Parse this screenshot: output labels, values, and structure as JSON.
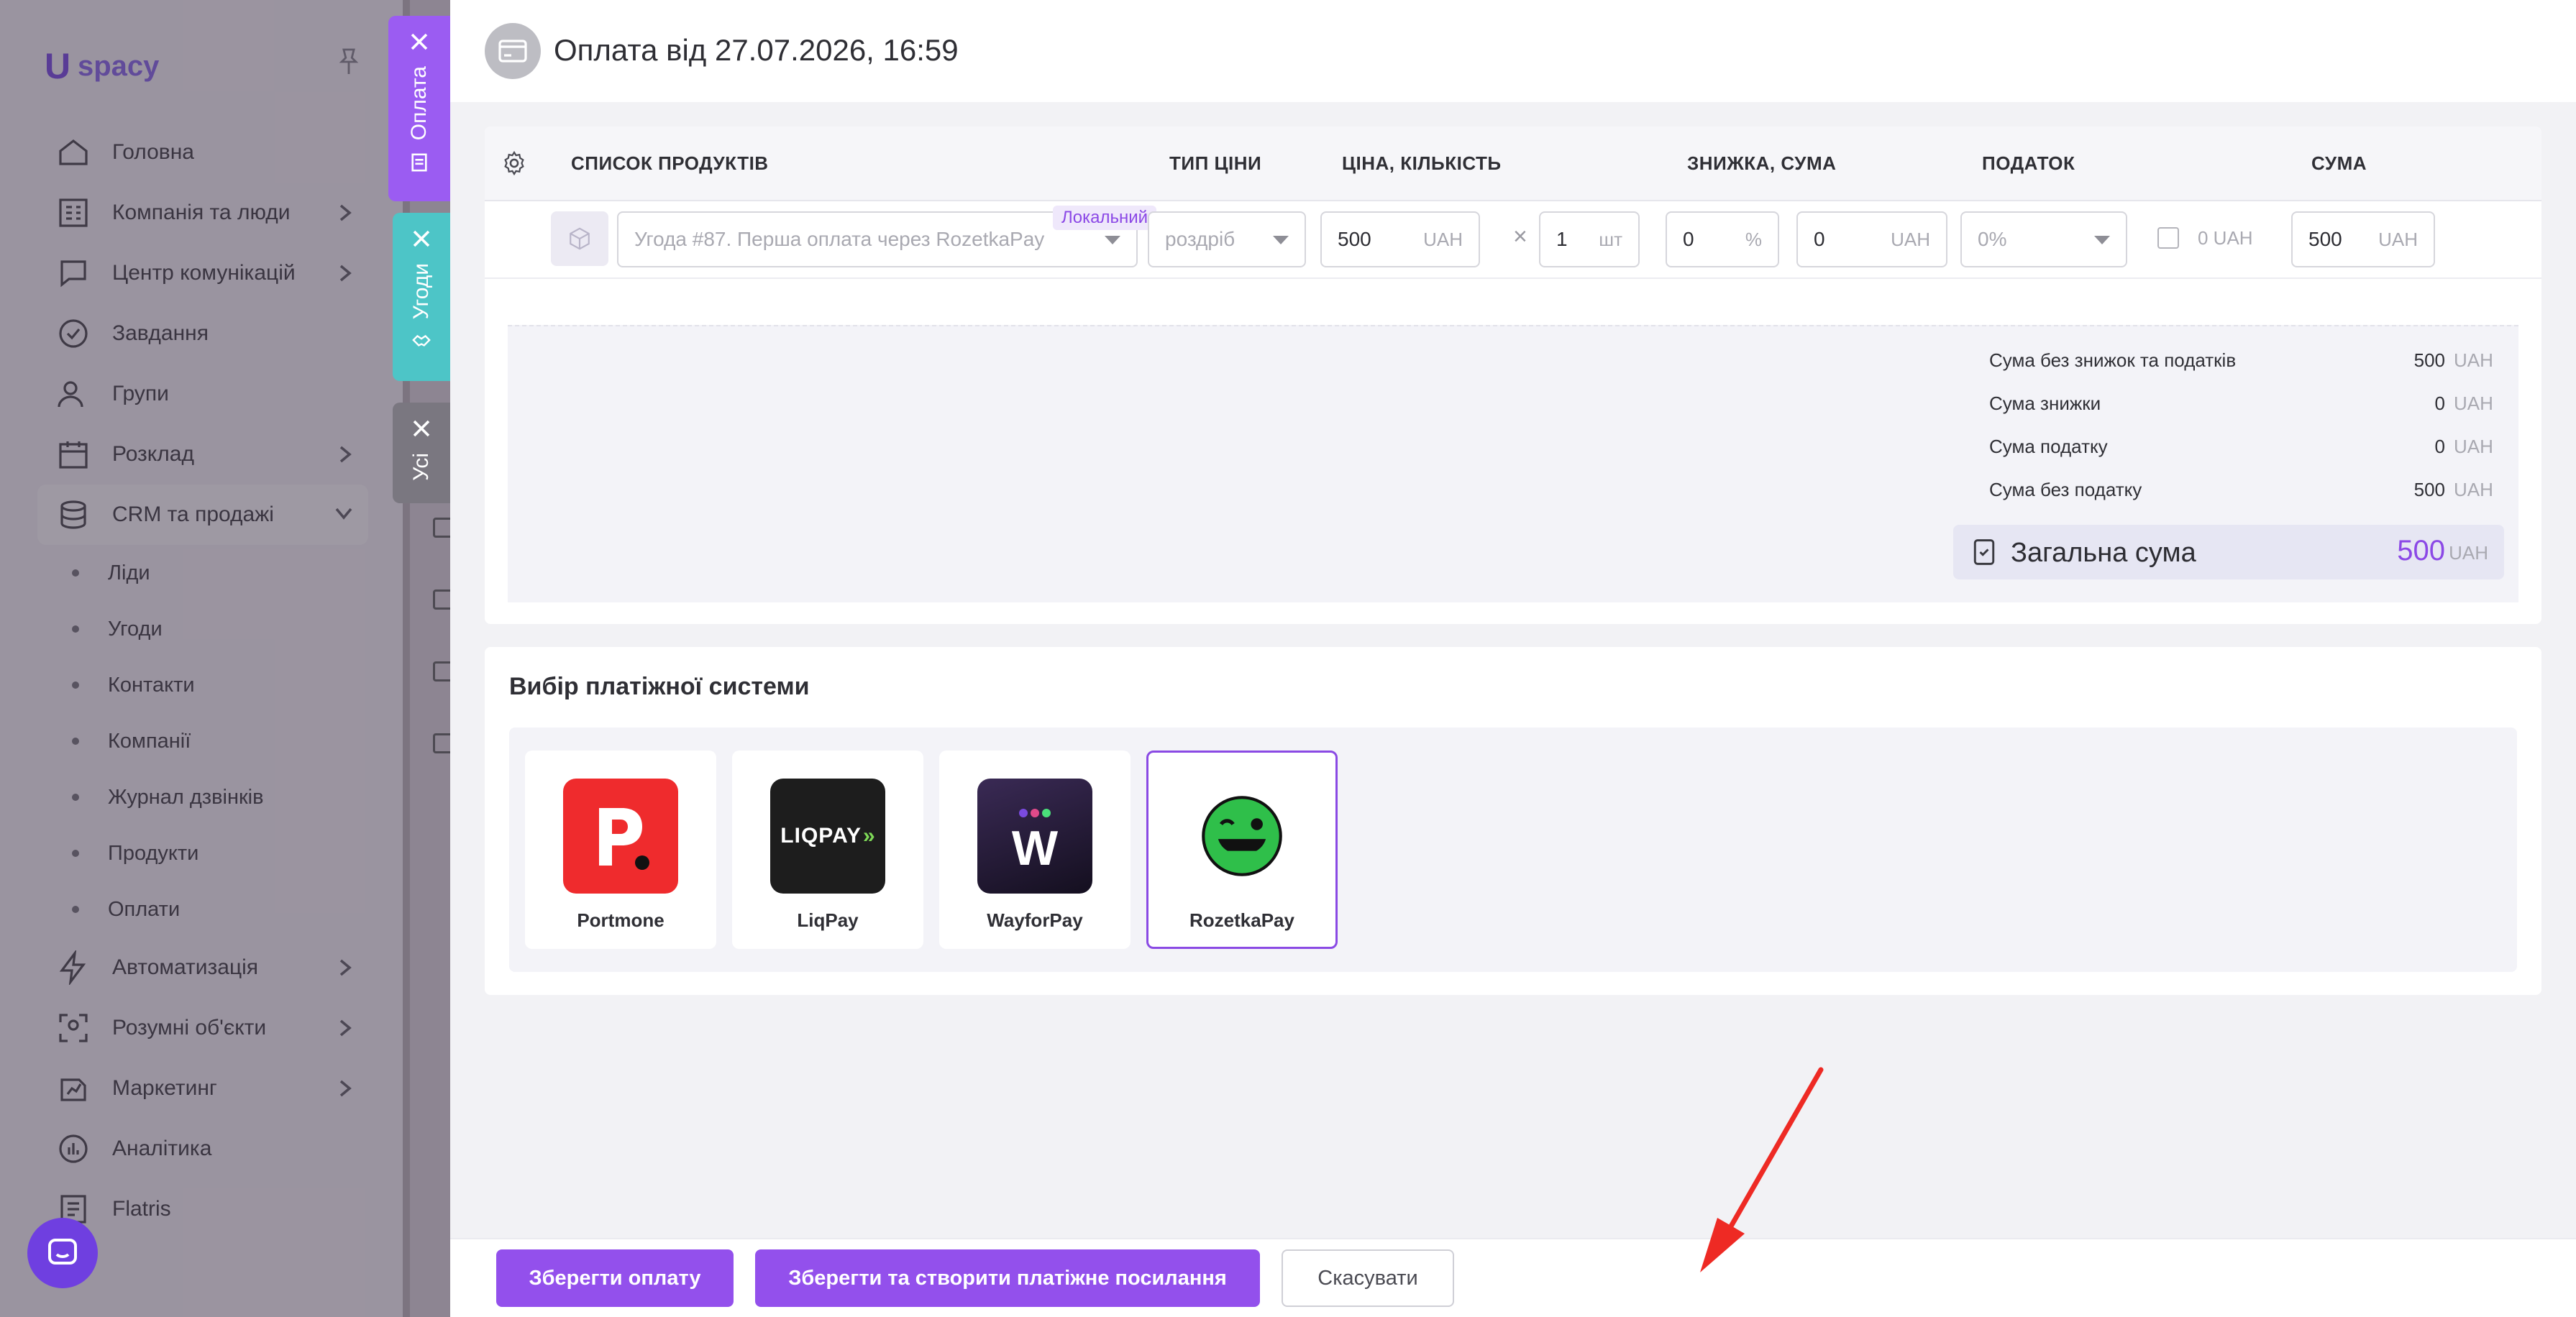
{
  "brand": {
    "logo_text": "spacy",
    "logo_mark": "U"
  },
  "sidebar": {
    "items": [
      {
        "label": "Головна",
        "icon": "home-icon"
      },
      {
        "label": "Компанія та люди",
        "icon": "company-icon"
      },
      {
        "label": "Центр комунікацій",
        "icon": "chat-icon"
      },
      {
        "label": "Завдання",
        "icon": "check-circle-icon"
      },
      {
        "label": "Групи",
        "icon": "users-icon"
      },
      {
        "label": "Розклад",
        "icon": "calendar-icon"
      },
      {
        "label": "CRM та продажі",
        "icon": "database-icon"
      }
    ],
    "crm_sub": [
      "Ліди",
      "Угоди",
      "Контакти",
      "Компанії",
      "Журнал дзвінків",
      "Продукти",
      "Оплати"
    ],
    "items_after": [
      {
        "label": "Автоматизація",
        "icon": "lightning-icon"
      },
      {
        "label": "Розумні об'єкти",
        "icon": "scan-icon"
      },
      {
        "label": "Маркетинг",
        "icon": "marketing-icon"
      },
      {
        "label": "Аналітика",
        "icon": "analytics-icon"
      },
      {
        "label": "Flatris",
        "icon": "flatris-icon"
      }
    ]
  },
  "tabs": {
    "payment": "Оплата",
    "deals": "Угоди",
    "all": "Усі"
  },
  "header": {
    "title": "Оплата від 27.07.2026, 16:59"
  },
  "products": {
    "columns": {
      "list": "СПИСОК ПРОДУКТІВ",
      "price_type": "ТИП ЦІНИ",
      "price_qty": "ЦІНА, КІЛЬКІСТЬ",
      "discount": "ЗНИЖКА, СУМА",
      "tax": "ПОДАТОК",
      "sum": "СУМА"
    },
    "row": {
      "product": "Угода #87. Перша оплата через RozetkaPay",
      "badge": "Локальний",
      "price_type": "роздріб",
      "price": "500",
      "price_unit": "UAH",
      "qty": "1",
      "qty_unit": "шт",
      "discount_pct": "0",
      "discount_pct_unit": "%",
      "discount_sum": "0",
      "discount_sum_unit": "UAH",
      "tax": "0%",
      "tax_amount": "0 UAH",
      "sum": "500",
      "sum_unit": "UAH"
    }
  },
  "summary": {
    "lines": [
      {
        "label": "Сума без знижок та податків",
        "value": "500",
        "unit": "UAH"
      },
      {
        "label": "Сума знижки",
        "value": "0",
        "unit": "UAH"
      },
      {
        "label": "Сума податку",
        "value": "0",
        "unit": "UAH"
      },
      {
        "label": "Сума без податку",
        "value": "500",
        "unit": "UAH"
      }
    ],
    "total_label": "Загальна сума",
    "total_value": "500",
    "total_unit": "UAH"
  },
  "payment_systems": {
    "title": "Вибір платіжної системи",
    "selected": "RozetkaPay",
    "items": [
      {
        "name": "Portmone",
        "logo_letter": "p",
        "color": "#ef2b2d"
      },
      {
        "name": "LiqPay",
        "logo_text": "LIQPAY",
        "color": "#1d1d1d"
      },
      {
        "name": "WayforPay",
        "logo_letter": "W",
        "color": "#2a1e3e"
      },
      {
        "name": "RozetkaPay",
        "color": "#2fbf4a"
      }
    ]
  },
  "footer": {
    "save": "Зберегти оплату",
    "save_link": "Зберегти та створити платіжне посилання",
    "cancel": "Скасувати"
  },
  "colors": {
    "accent": "#9350ec",
    "teal": "#4dc5c7"
  }
}
